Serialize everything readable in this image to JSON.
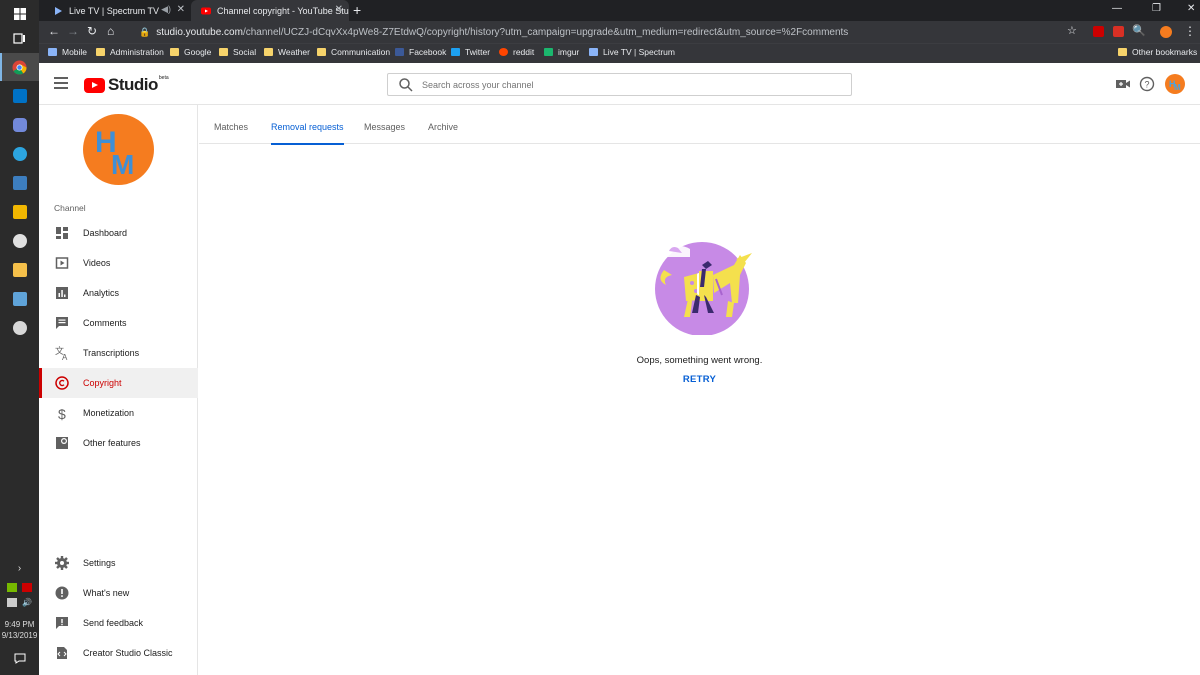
{
  "taskbar": {
    "clock_time": "9:49 PM",
    "clock_date": "9/13/2019"
  },
  "browser": {
    "tabs": [
      {
        "label": "Live TV | Spectrum TV"
      },
      {
        "label": "Channel copyright - YouTube Stu"
      }
    ],
    "new_tab": "+",
    "url_host": "studio.youtube.com",
    "url_path": "/channel/UCZJ-dCqvXx4pWe8-Z7EtdwQ/copyright/history?utm_campaign=upgrade&utm_medium=redirect&utm_source=%2Fcomments",
    "bookmarks": [
      {
        "label": "Mobile",
        "icon": "star-icon",
        "color": "#8ab4f8"
      },
      {
        "label": "Administration",
        "icon": "folder-icon",
        "color": "#f6d36b"
      },
      {
        "label": "Google",
        "icon": "folder-icon",
        "color": "#f6d36b"
      },
      {
        "label": "Social",
        "icon": "folder-icon",
        "color": "#f6d36b"
      },
      {
        "label": "Weather",
        "icon": "folder-icon",
        "color": "#f6d36b"
      },
      {
        "label": "Communication",
        "icon": "folder-icon",
        "color": "#f6d36b"
      },
      {
        "label": "Facebook",
        "icon": "facebook-icon",
        "color": "#3b5998"
      },
      {
        "label": "Twitter",
        "icon": "twitter-icon",
        "color": "#1da1f2"
      },
      {
        "label": "reddit",
        "icon": "reddit-icon",
        "color": "#ff4500"
      },
      {
        "label": "imgur",
        "icon": "imgur-icon",
        "color": "#1bb76e"
      },
      {
        "label": "Live TV | Spectrum",
        "icon": "play-icon",
        "color": "#8ab4f8"
      }
    ],
    "other_bookmarks": "Other bookmarks"
  },
  "studio": {
    "logo_text": "Studio",
    "logo_badge": "beta",
    "search_placeholder": "Search across your channel",
    "channel_label": "Channel",
    "channel_initials": "HM",
    "nav": [
      {
        "label": "Dashboard",
        "icon": "dashboard-icon"
      },
      {
        "label": "Videos",
        "icon": "videos-icon"
      },
      {
        "label": "Analytics",
        "icon": "analytics-icon"
      },
      {
        "label": "Comments",
        "icon": "comments-icon"
      },
      {
        "label": "Transcriptions",
        "icon": "transcriptions-icon"
      },
      {
        "label": "Copyright",
        "icon": "copyright-icon",
        "active": true
      },
      {
        "label": "Monetization",
        "icon": "monetization-icon"
      },
      {
        "label": "Other features",
        "icon": "other-features-icon"
      }
    ],
    "nav_bottom": [
      {
        "label": "Settings",
        "icon": "settings-icon"
      },
      {
        "label": "What's new",
        "icon": "whats-new-icon"
      },
      {
        "label": "Send feedback",
        "icon": "feedback-icon"
      },
      {
        "label": "Creator Studio Classic",
        "icon": "classic-icon"
      }
    ],
    "tabs": [
      {
        "label": "Matches"
      },
      {
        "label": "Removal requests",
        "active": true
      },
      {
        "label": "Messages"
      },
      {
        "label": "Archive"
      }
    ],
    "error_message": "Oops, something went wrong.",
    "retry_label": "RETRY",
    "accent_color": "#065fd4",
    "active_nav_color": "#cc0000"
  }
}
